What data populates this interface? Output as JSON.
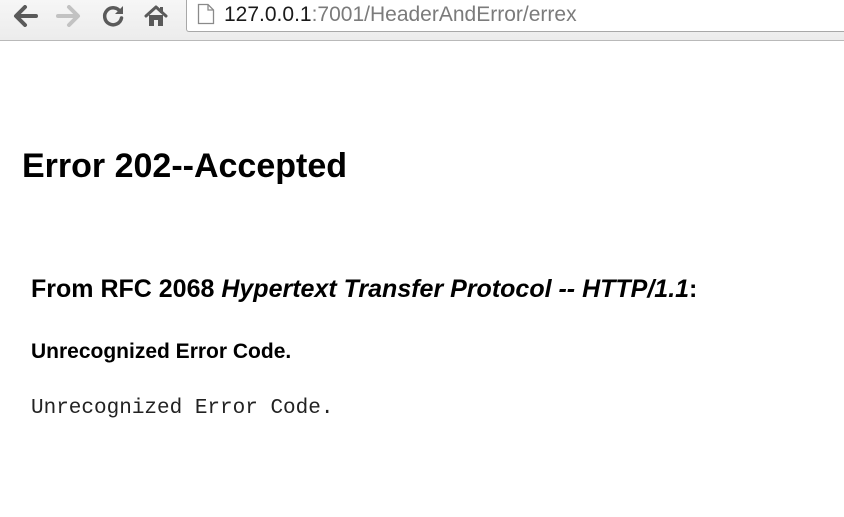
{
  "browser": {
    "url_host": "127.0.0.1",
    "url_rest": ":7001/HeaderAndError/errex"
  },
  "page": {
    "title": "Error 202--Accepted",
    "rfc_prefix": "From RFC 2068 ",
    "rfc_title": "Hypertext Transfer Protocol -- HTTP/1.1",
    "rfc_suffix": ":",
    "subheading": "Unrecognized Error Code.",
    "body": "Unrecognized Error Code."
  },
  "icons": [
    "back-arrow-icon",
    "forward-arrow-icon",
    "reload-icon",
    "home-icon",
    "page-icon"
  ],
  "colors": {
    "toolbar_bg": "#ececec",
    "icon_active": "#5a5a5a",
    "icon_disabled": "#c2c2c2",
    "url_host": "#1a1a1a",
    "url_path": "#7b7b7b"
  }
}
